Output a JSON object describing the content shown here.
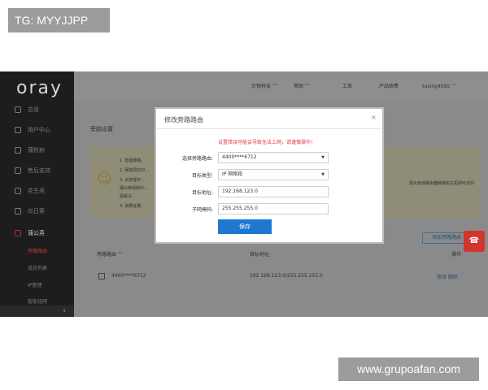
{
  "watermark": {
    "tag": "TG: MYYJJPP",
    "url": "www.grupoafan.com"
  },
  "sidebar": {
    "logo": "oray",
    "items": [
      {
        "label": "总览",
        "icon": "grid-icon"
      },
      {
        "label": "用户中心",
        "icon": "user-icon"
      },
      {
        "label": "蒲牧树",
        "icon": "tree-icon"
      },
      {
        "label": "售后支持",
        "icon": "support-icon"
      },
      {
        "label": "花生壳",
        "icon": "peanut-icon"
      },
      {
        "label": "向日葵",
        "icon": "sunflower-icon"
      },
      {
        "label": "蒲公英",
        "icon": "dandelion-icon"
      }
    ],
    "subitems": [
      {
        "label": "旁路路由",
        "active": true
      },
      {
        "label": "成员列表",
        "active": false
      },
      {
        "label": "IP管理",
        "active": false
      },
      {
        "label": "智能组网",
        "active": false
      }
    ],
    "collapse_glyph": "‹"
  },
  "topbar": {
    "nav": [
      "贝锐科技 ﹀",
      "帮助 ﹀",
      "工单",
      "产品续费",
      "tuxing4565 ﹀"
    ]
  },
  "content": {
    "title": "旁路设置",
    "notice_lines": [
      "1. 智能旁路...",
      "2. 网络层的中...",
      "3. 云管理平...",
      "蒲公英组网中...",
      "需解决...",
      "4. 如果证期..."
    ],
    "notice_right": "找出其他路由器链接的主机即可访问",
    "add_button": "添加旁路路由",
    "table_headers": [
      "旁路路由 ﹀",
      "目标地址",
      "操作"
    ],
    "table_row": {
      "router": "4400****6712",
      "target": "192.168.123.0/255.255.255.0",
      "actions": "修改  删除"
    },
    "float_icon": "headset-icon"
  },
  "modal": {
    "title": "修改旁路路由",
    "close": "×",
    "warning": "设置错误可能会导致无法上网，请谨慎操作!",
    "labels": [
      "选择旁路路由:",
      "目标类型:",
      "目标地址:",
      "子网掩码:"
    ],
    "router_select": "4400****6712",
    "type_select": "IP 网络段",
    "target_address": "192.168.123.0",
    "subnet_mask": "255.255.255.0",
    "save": "保存"
  }
}
